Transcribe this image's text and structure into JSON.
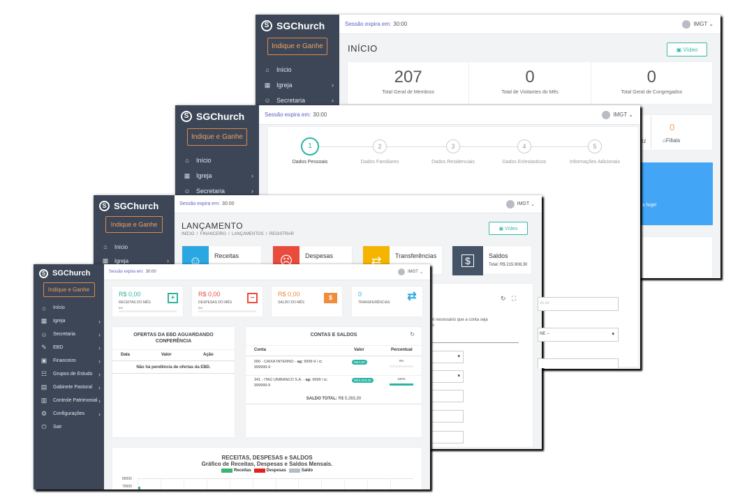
{
  "shared": {
    "app_name": "SGChurch",
    "refer_label": "Indique e Ganhe",
    "session_label": "Sessão expira em:",
    "session_time": "30:00",
    "user_name": "IMGT"
  },
  "w1": {
    "page_title": "INÍCIO",
    "video_label": "Vídeo",
    "nav": [
      "Início",
      "Igreja",
      "Secretaria"
    ],
    "stats": [
      {
        "value": "207",
        "label": "Total Geral de Membros"
      },
      {
        "value": "0",
        "label": "Total de Visitantes do Mês"
      },
      {
        "value": "0",
        "label": "Total Geral de Congregados"
      }
    ],
    "row2_frag": "riz",
    "row2_value": "0",
    "row2_label": "Filiais",
    "banner_text": "s hoje!"
  },
  "w2": {
    "nav": [
      "Início",
      "Igreja",
      "Secretaria"
    ],
    "steps": [
      {
        "num": "1",
        "label": "Dados Pessoais"
      },
      {
        "num": "2",
        "label": "Dados Familiares"
      },
      {
        "num": "3",
        "label": "Dados Residenciais"
      },
      {
        "num": "4",
        "label": "Dados Eclesiasticos"
      },
      {
        "num": "5",
        "label": "Informações Adicionais"
      }
    ]
  },
  "w3": {
    "page_title": "LANÇAMENTO",
    "breadcrumb": "INÍCIO  /  FINANCEIRO  /  LANÇAMENTOS  /  REGISTRAR",
    "video_label": "Vídeo",
    "nav": [
      "Início",
      "Igreja"
    ],
    "tiles": [
      {
        "label": "Receitas",
        "color": "#2aa7e0",
        "icon": "☺"
      },
      {
        "label": "Despesas",
        "color": "#e94b3c",
        "icon": "☹"
      },
      {
        "label": "Transferências",
        "color": "#f4b400",
        "icon": "⇄"
      },
      {
        "label": "Saldos",
        "sub": "Total: R$ 215.908,30",
        "color": "#455366",
        "icon": "$"
      }
    ],
    "form_note": "é necessário que a conta seja",
    "form_note2": "s",
    "select_frag": "NE --",
    "input_frag": "xx.xx"
  },
  "w4": {
    "nav": [
      {
        "label": "Início",
        "icon": "home-icon",
        "glyph": "⌂",
        "chev": false
      },
      {
        "label": "Igreja",
        "icon": "grid-icon",
        "glyph": "▦",
        "chev": true
      },
      {
        "label": "Secretaria",
        "icon": "users-icon",
        "glyph": "☺",
        "chev": true
      },
      {
        "label": "EBD",
        "icon": "graduation-icon",
        "glyph": "✎",
        "chev": true
      },
      {
        "label": "Financeiro",
        "icon": "money-icon",
        "glyph": "▣",
        "chev": true
      },
      {
        "label": "Grupos de Estudo",
        "icon": "group-icon",
        "glyph": "☷",
        "chev": true
      },
      {
        "label": "Gabinete Pastoral",
        "icon": "book-icon",
        "glyph": "▤",
        "chev": true
      },
      {
        "label": "Controle Patrimonial",
        "icon": "box-icon",
        "glyph": "▥",
        "chev": true
      },
      {
        "label": "Configurações",
        "icon": "gear-icon",
        "glyph": "⚙",
        "chev": true
      },
      {
        "label": "Sair",
        "icon": "power-icon",
        "glyph": "⏻",
        "chev": false
      }
    ],
    "summary": [
      {
        "value": "R$ 0,00",
        "label": "RECEITAS DO MÊS",
        "pct": "0%",
        "color": "#31b0a0",
        "icon": "plus-box-icon",
        "glyph": "+"
      },
      {
        "value": "R$ 0,00",
        "label": "DESPESAS DO MÊS",
        "pct": "0%",
        "color": "#e94b3c",
        "icon": "minus-box-icon",
        "glyph": "−"
      },
      {
        "value": "R$ 0,00",
        "label": "SALDO DO MÊS",
        "pct": "",
        "color": "#f08c3a",
        "icon": "cash-icon",
        "glyph": "$"
      },
      {
        "value": "0",
        "label": "TRANSFERÊNCIAS",
        "pct": "",
        "color": "#2aa7e0",
        "icon": "transfer-icon",
        "glyph": "⇄"
      }
    ],
    "offers": {
      "title": "OFERTAS DA EBD AGUARDANDO CONFERÊNCIA",
      "cols": [
        "Data",
        "Valor",
        "Ação"
      ],
      "empty": "Não há pendência de ofertas da EBD."
    },
    "accounts": {
      "title": "CONTAS E SALDOS",
      "cols": [
        "Conta",
        "Valor",
        "Percentual"
      ],
      "rows": [
        {
          "l1a": "000 - CAIXA INTERNO - ",
          "ag_label": "ag:",
          "ag": " 9999-9 / ",
          "c_label": "c:",
          "l2": "999999-9",
          "value": "R$ 0,00",
          "pct": "0%",
          "pct_num": 0
        },
        {
          "l1a": "341 - ITAÚ UNIBANCO S.A. - ",
          "ag_label": "ag:",
          "ag": " 9999 / ",
          "c_label": "c:",
          "l2": "999999-9",
          "value": "R$ 5.263,30",
          "pct": "100%",
          "pct_num": 100
        }
      ],
      "total_label": "SALDO TOTAL:",
      "total_value": "R$ 5.263,30"
    },
    "chart": {
      "title": "RECEITAS, DESPESAS e SALDOS",
      "subtitle": "Gráfico de Receitas, Despesas e Saldos Mensais.",
      "legend": [
        {
          "name": "Receitas",
          "color": "#3cb371"
        },
        {
          "name": "Despesas",
          "color": "#e8201a"
        },
        {
          "name": "Saldo",
          "color": "#b5bcc3"
        }
      ],
      "yticks": [
        "80000",
        "70000"
      ]
    }
  }
}
